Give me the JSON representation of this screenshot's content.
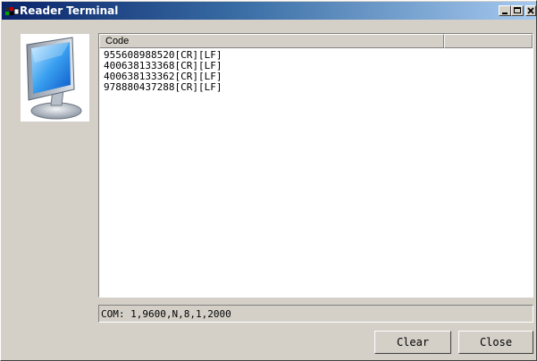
{
  "window": {
    "title": "Reader Terminal"
  },
  "list": {
    "columns": [
      "Code",
      ""
    ],
    "rows": [
      "955608988520[CR][LF]",
      "400638133368[CR][LF]",
      "400638133362[CR][LF]",
      "978880437288[CR][LF]"
    ]
  },
  "status": {
    "text": "COM: 1,9600,N,8,1,2000"
  },
  "buttons": {
    "clear_label": "Clear",
    "close_label": "Close"
  },
  "icons": {
    "title": "app-icon",
    "monitor": "monitor-icon"
  },
  "colors": {
    "titlebar_start": "#0a246a",
    "titlebar_end": "#a6caf0",
    "face": "#d4d0c8"
  }
}
